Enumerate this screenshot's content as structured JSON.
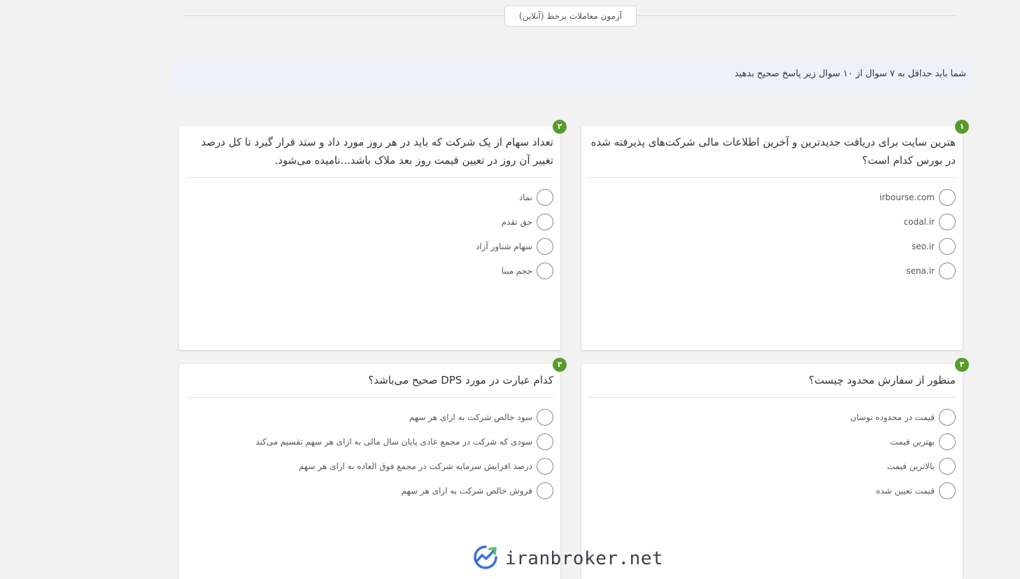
{
  "header": {
    "quiz_title": "آزمون معاملات برخط (آنلاین)"
  },
  "notice": "شما باید حداقل به ۷ سوال از ۱۰ سوال زیر پاسخ صحیح بدهید",
  "questions": [
    {
      "number": "۱",
      "text": "هترین سایت برای دریافت جدیدترین و آخرین اطلاعات مالی شرکت‌های پذیرفته شده در بورس کدام است؟",
      "options": [
        "irbourse.com",
        "codal.ir",
        "seo.ir",
        "sena.ir"
      ]
    },
    {
      "number": "۲",
      "text": "تعداد سهام از یک شرکت که باید در هر روز مورد داد و ستد قرار گیرد تا کل درصد تغییر آن روز در تعیین قیمت روز بعد ملاک باشد...نامیده می‌شود.",
      "options": [
        "نماد",
        "حق تقدم",
        "سهام شناور آزاد",
        "حجم مبنا"
      ]
    },
    {
      "number": "۳",
      "text": "منظور از سفارش محدود چیست؟",
      "options": [
        "قیمت در محدوده نوسان",
        "بهترین قیمت",
        "بالاترین قیمت",
        "قیمت تعیین شده"
      ]
    },
    {
      "number": "۴",
      "text": "کدام عبارت در مورد DPS صحیح می‌باشد؟",
      "options": [
        "سود خالص شرکت به ازای هر سهم",
        "سودی که شرکت در مجمع عادی پایان سال مالی به ازای هر سهم تقسیم می‌کند",
        "درصد افزایش سرمایه شرکت در مجمع فوق العاده به ازای هر سهم",
        "فروش خالص شرکت به ازای هر سهم"
      ]
    }
  ],
  "watermark": {
    "text": "iranbroker.net",
    "icon": "growth-chart-logo-icon",
    "colors": {
      "blue": "#3b6fe0",
      "green": "#5bc26a"
    }
  },
  "colors": {
    "badge": "#5a9a2b",
    "notice_bg": "#eef1fb",
    "page_bg": "#f2f2f2"
  }
}
